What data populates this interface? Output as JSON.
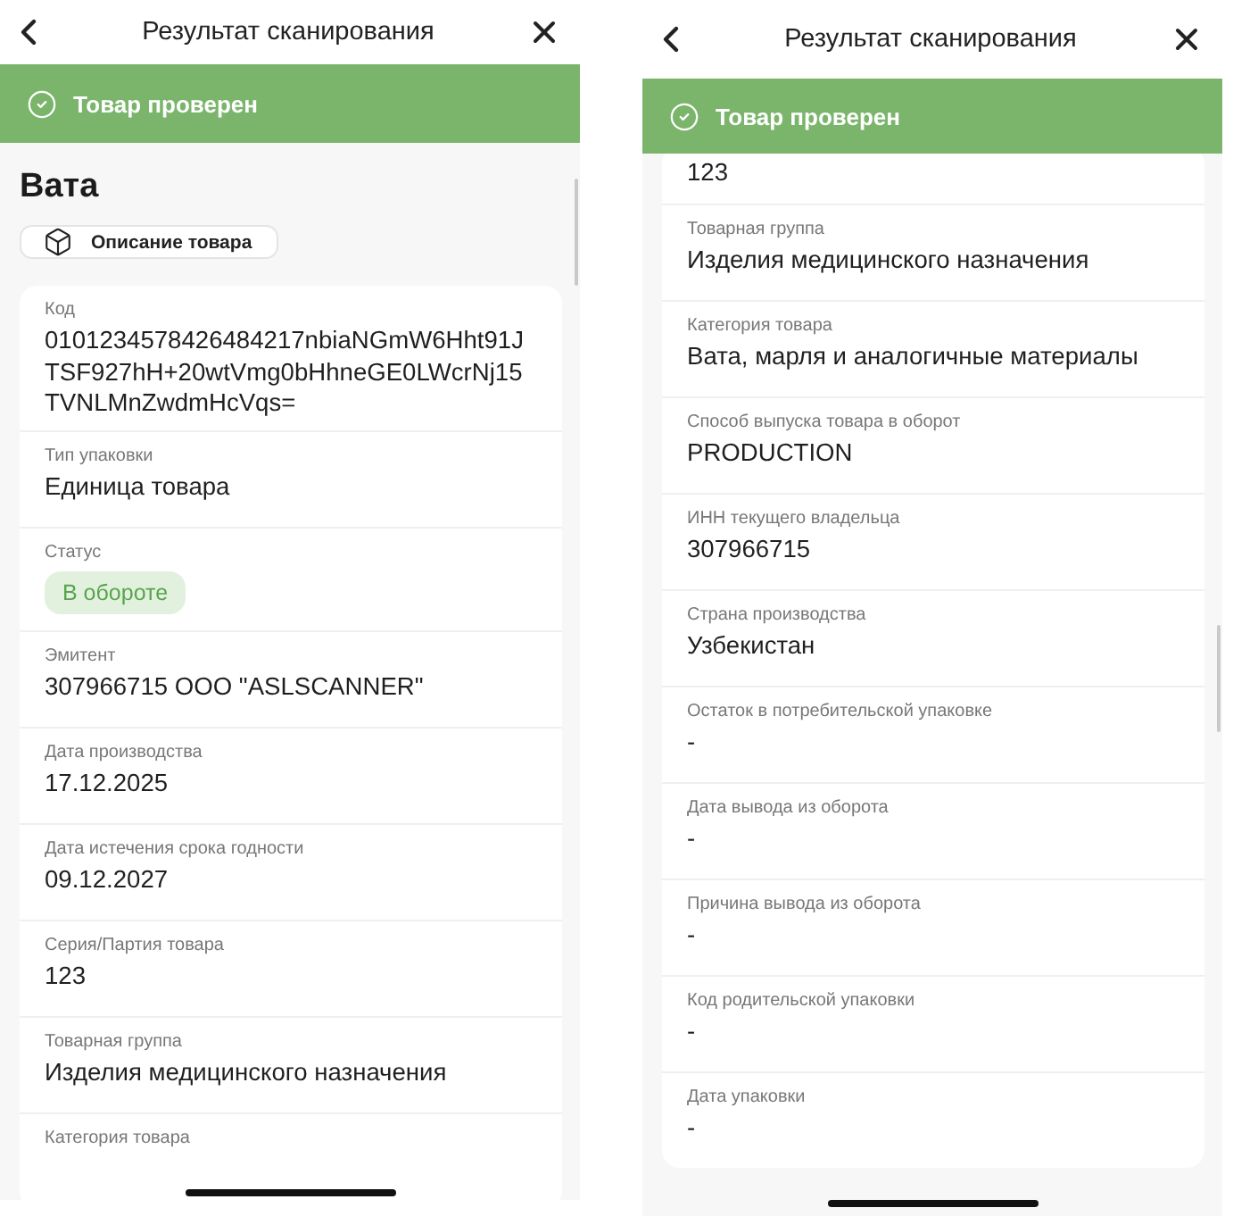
{
  "screens": [
    {
      "title": "Результат сканирования",
      "banner": "Товар проверен",
      "heading": "Вата",
      "description_button": "Описание товара",
      "rows": [
        {
          "kind": "text",
          "label": "Код",
          "value": "0101234578426484217nbiaNGmW6Hht91JTSF927hH+20wtVmg0bHhneGE0LWcrNj15TVNLMnZwdmHcVqs="
        },
        {
          "kind": "text",
          "label": "Тип упаковки",
          "value": "Единица товара"
        },
        {
          "kind": "status",
          "label": "Статус",
          "value": "В обороте"
        },
        {
          "kind": "text",
          "label": "Эмитент",
          "value": "307966715 ООО \"ASLSCANNER\""
        },
        {
          "kind": "text",
          "label": "Дата производства",
          "value": "17.12.2025"
        },
        {
          "kind": "text",
          "label": "Дата истечения срока годности",
          "value": "09.12.2027"
        },
        {
          "kind": "text",
          "label": "Серия/Партия товара",
          "value": "123"
        },
        {
          "kind": "text",
          "label": "Товарная группа",
          "value": "Изделия медицинского назначения"
        },
        {
          "kind": "text",
          "label": "Категория товара"
        }
      ]
    },
    {
      "title": "Результат сканирования",
      "banner": "Товар проверен",
      "rows": [
        {
          "kind": "text",
          "value": "123"
        },
        {
          "kind": "text",
          "label": "Товарная группа",
          "value": "Изделия медицинского назначения"
        },
        {
          "kind": "text",
          "label": "Категория товара",
          "value": "Вата, марля и аналогичные материалы"
        },
        {
          "kind": "text",
          "label": "Способ выпуска товара в оборот",
          "value": "PRODUCTION"
        },
        {
          "kind": "text",
          "label": "ИНН текущего владельца",
          "value": "307966715"
        },
        {
          "kind": "text",
          "label": "Страна производства",
          "value": "Узбекистан"
        },
        {
          "kind": "text",
          "label": "Остаток в потребительской упаковке",
          "value": "-"
        },
        {
          "kind": "text",
          "label": "Дата вывода из оборота",
          "value": "-"
        },
        {
          "kind": "text",
          "label": "Причина вывода из оборота",
          "value": "-"
        },
        {
          "kind": "text",
          "label": "Код родительской упаковки",
          "value": "-"
        },
        {
          "kind": "text",
          "label": "Дата упаковки",
          "value": "-"
        }
      ]
    }
  ]
}
